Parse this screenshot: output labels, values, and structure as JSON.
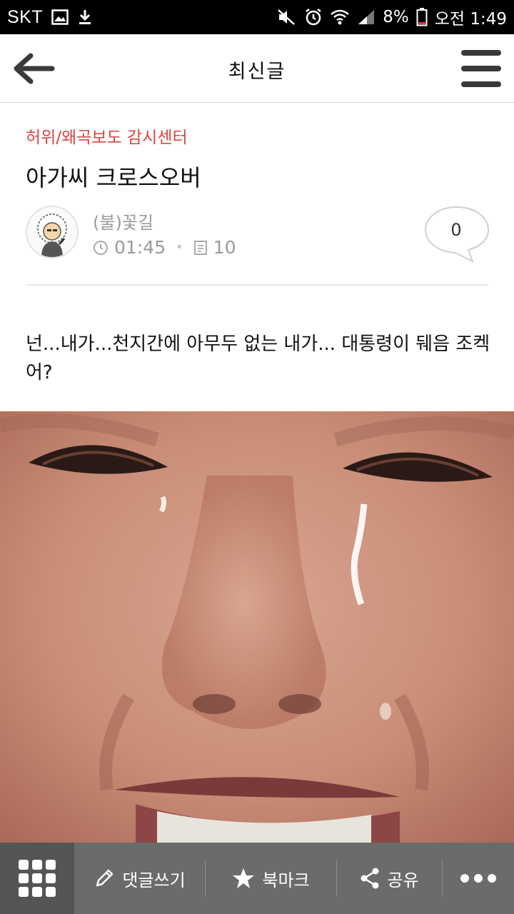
{
  "status_bar": {
    "carrier": "SKT",
    "battery": "8%",
    "time": "오전 1:49"
  },
  "header": {
    "title": "최신글",
    "back_icon": "arrow-left-icon",
    "menu_icon": "hamburger-menu-icon"
  },
  "post": {
    "category": "허위/왜곡보도 감시센터",
    "title": "아가씨 크로스오버",
    "author": "(불)꽃길",
    "time": "01:45",
    "views": "10",
    "comment_count": "0",
    "body": "넌...내가...천지간에 아무두 없는 내가... 대통령이 뒈음 조켁어?"
  },
  "bottom_bar": {
    "comment": "댓글쓰기",
    "bookmark": "북마크",
    "share": "공유"
  },
  "colors": {
    "category": "#d9443e",
    "bottom_bar": "#6b6b6b",
    "status_bar": "#000000"
  }
}
